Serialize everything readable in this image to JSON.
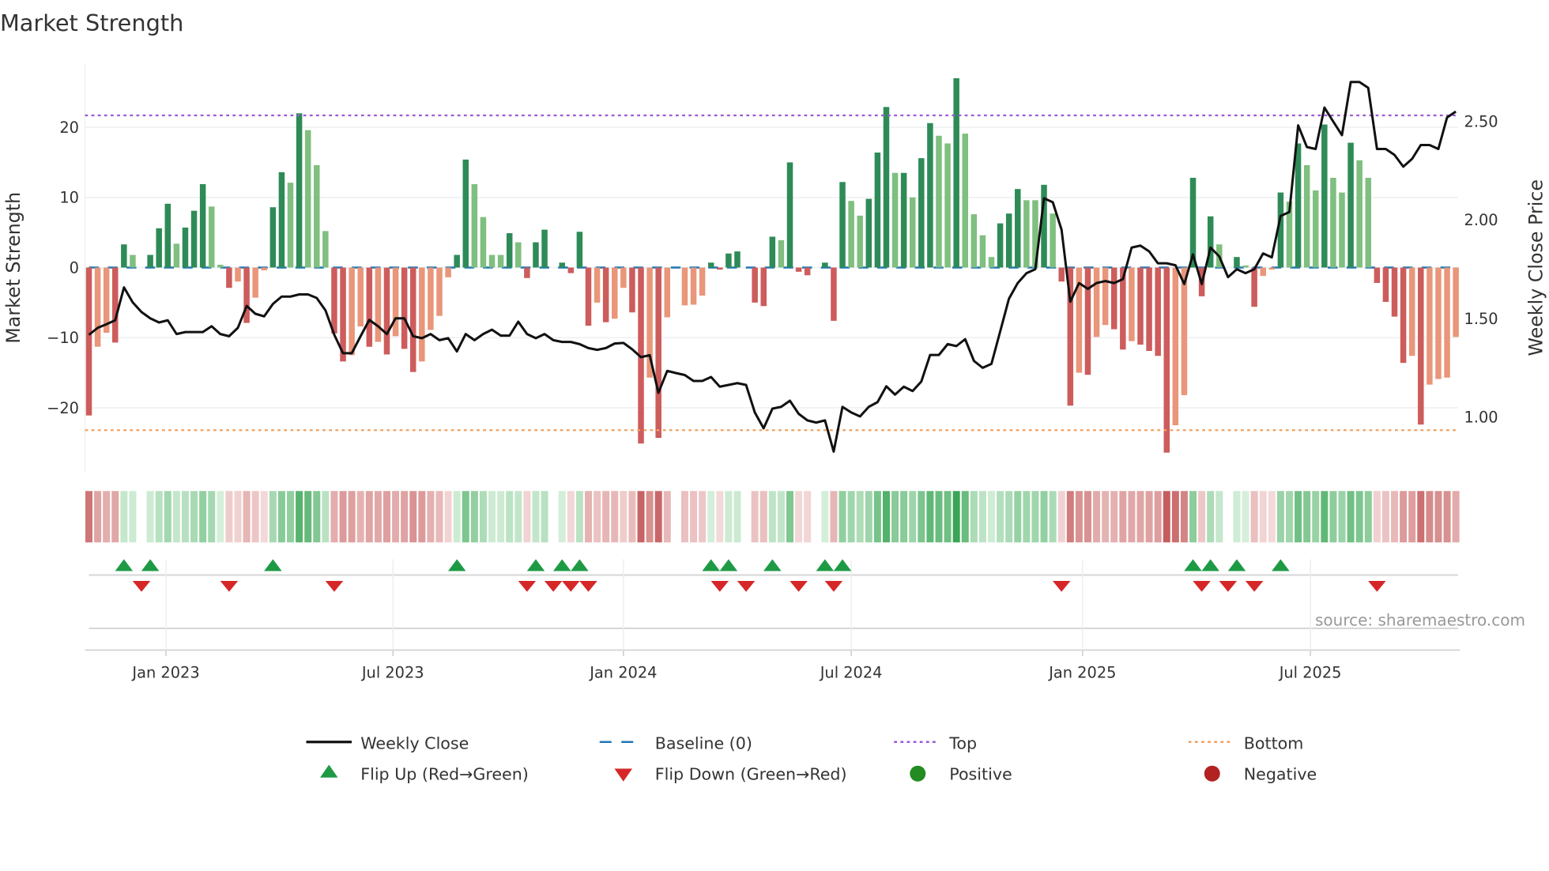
{
  "title": "Market Strength",
  "source": "source: sharemaestro.com",
  "colors": {
    "pos_strong": "#2e8b57",
    "pos_weak": "#7fbf7f",
    "neg_strong": "#cd5c5c",
    "neg_weak": "#e9967a",
    "line": "#111111",
    "baseline": "#1f77b4",
    "top": "#9b59d6",
    "bottom": "#f0a060",
    "flip_up": "#1e9a45",
    "flip_down": "#d62728",
    "positive": "#228b22",
    "negative": "#b22222"
  },
  "legend": [
    {
      "label": "Weekly Close",
      "symbol": "line"
    },
    {
      "label": "Baseline (0)",
      "symbol": "dash"
    },
    {
      "label": "Top",
      "symbol": "dot-purple"
    },
    {
      "label": "Bottom",
      "symbol": "dot-orange"
    },
    {
      "label": "Flip Up (Red→Green)",
      "symbol": "triangle-up"
    },
    {
      "label": "Flip Down (Green→Red)",
      "symbol": "triangle-down"
    },
    {
      "label": "Positive",
      "symbol": "circle-green"
    },
    {
      "label": "Negative",
      "symbol": "circle-red"
    }
  ],
  "chart_data": {
    "type": "bar",
    "title": "Market Strength",
    "ylabel": "Market Strength",
    "y2label": "Weekly Close Price",
    "ylim": [
      -29.2,
      29
    ],
    "y2lim": [
      0.72,
      2.79
    ],
    "yticks": [
      {
        "v": -20,
        "label": "−20"
      },
      {
        "v": -10,
        "label": "−10"
      },
      {
        "v": 0,
        "label": "0"
      },
      {
        "v": 10,
        "label": "10"
      },
      {
        "v": 20,
        "label": "20"
      }
    ],
    "y2ticks": [
      {
        "v": 1.0,
        "label": "1.00"
      },
      {
        "v": 1.5,
        "label": "1.50"
      },
      {
        "v": 2.0,
        "label": "2.00"
      },
      {
        "v": 2.5,
        "label": "2.50"
      }
    ],
    "xticks": [
      {
        "week": 8.8,
        "label": "Jan 2023"
      },
      {
        "week": 34.7,
        "label": "Jul 2023"
      },
      {
        "week": 61.0,
        "label": "Jan 2024"
      },
      {
        "week": 87.0,
        "label": "Jul 2024"
      },
      {
        "week": 113.4,
        "label": "Jan 2025"
      },
      {
        "week": 139.4,
        "label": "Jul 2025"
      }
    ],
    "top_level": 21.7,
    "bottom_level": -23.2,
    "baseline": 0,
    "grid": true,
    "legend_position": "bottom",
    "strength": [
      -21.1,
      -11.3,
      -9.3,
      -10.7,
      3.3,
      1.8,
      0,
      1.8,
      5.6,
      9.1,
      3.4,
      5.7,
      8.1,
      11.9,
      8.7,
      0.4,
      -2.9,
      -2.0,
      -7.9,
      -4.3,
      -0.4,
      8.6,
      13.6,
      12.1,
      22.0,
      19.6,
      14.6,
      5.2,
      -9.4,
      -13.4,
      -12.5,
      -8.4,
      -11.3,
      -10.6,
      -12.4,
      -9.8,
      -11.6,
      -14.9,
      -13.4,
      -8.9,
      -6.9,
      -1.4,
      1.8,
      15.4,
      11.9,
      7.2,
      1.8,
      1.8,
      4.9,
      3.6,
      -1.5,
      3.6,
      5.4,
      0,
      0.7,
      -0.8,
      5.1,
      -8.3,
      -5.0,
      -7.8,
      -7.3,
      -2.9,
      -6.4,
      -25.1,
      -15.7,
      -24.3,
      -7.1,
      0,
      -5.4,
      -5.3,
      -4.0,
      0.7,
      -0.3,
      2.0,
      2.3,
      0,
      -5.0,
      -5.5,
      4.4,
      3.9,
      15.0,
      -0.6,
      -1.1,
      0,
      0.7,
      -7.6,
      12.2,
      9.5,
      7.4,
      9.8,
      16.4,
      22.9,
      13.5,
      13.5,
      10.0,
      15.6,
      20.6,
      18.8,
      17.7,
      27.0,
      19.1,
      7.6,
      4.6,
      1.5,
      6.3,
      7.7,
      11.2,
      9.6,
      9.6,
      11.8,
      7.7,
      -2.0,
      -19.7,
      -15.0,
      -15.3,
      -9.9,
      -8.2,
      -8.8,
      -11.7,
      -10.5,
      -11.0,
      -11.9,
      -12.6,
      -26.4,
      -22.5,
      -18.2,
      12.8,
      -4.1,
      7.3,
      3.3,
      0,
      1.5,
      0.3,
      -5.6,
      -1.2,
      -0.3,
      10.7,
      9.4,
      17.7,
      14.6,
      11.0,
      20.4,
      12.8,
      10.7,
      17.8,
      15.3,
      12.8,
      -2.2,
      -4.9,
      -7.0,
      -13.6,
      -12.6,
      -22.4,
      -16.7,
      -15.9,
      -15.7,
      -9.9
    ],
    "shade": "RrrRGg0GGGgGGGggRrRrrGGgGgggRRrrRrRrRRrrrrGGggggGgRGG0GRGRrRrrRRrRr0rrrGRGG0RRGgGRR0GRGggGGGgGgGGggGggggGGGggGgRRrRrrRRrRRRRrrGRGg0GgRrrGgGggGggGggRRRRrRrrrr",
    "weekly_close": [
      1.417,
      1.453,
      1.471,
      1.491,
      1.658,
      1.582,
      1.533,
      1.501,
      1.48,
      1.491,
      1.421,
      1.431,
      1.431,
      1.431,
      1.461,
      1.421,
      1.41,
      1.453,
      1.564,
      1.524,
      1.511,
      1.574,
      1.611,
      1.611,
      1.622,
      1.622,
      1.604,
      1.541,
      1.417,
      1.324,
      1.324,
      1.41,
      1.493,
      1.461,
      1.421,
      1.501,
      1.501,
      1.41,
      1.4,
      1.421,
      1.39,
      1.4,
      1.333,
      1.421,
      1.39,
      1.421,
      1.443,
      1.413,
      1.413,
      1.484,
      1.421,
      1.4,
      1.421,
      1.39,
      1.381,
      1.381,
      1.37,
      1.35,
      1.341,
      1.35,
      1.373,
      1.376,
      1.344,
      1.304,
      1.314,
      1.123,
      1.234,
      1.223,
      1.213,
      1.183,
      1.183,
      1.203,
      1.154,
      1.163,
      1.172,
      1.163,
      1.023,
      0.943,
      1.043,
      1.052,
      1.083,
      1.016,
      0.983,
      0.972,
      0.983,
      0.825,
      1.052,
      1.023,
      1.003,
      1.052,
      1.076,
      1.156,
      1.114,
      1.154,
      1.132,
      1.18,
      1.315,
      1.315,
      1.37,
      1.36,
      1.395,
      1.285,
      1.25,
      1.27,
      1.435,
      1.6,
      1.68,
      1.73,
      1.75,
      2.11,
      2.09,
      1.95,
      1.585,
      1.68,
      1.65,
      1.68,
      1.69,
      1.68,
      1.7,
      1.86,
      1.87,
      1.84,
      1.78,
      1.78,
      1.77,
      1.675,
      1.825,
      1.675,
      1.86,
      1.815,
      1.71,
      1.75,
      1.73,
      1.75,
      1.83,
      1.81,
      2.02,
      2.04,
      2.48,
      2.37,
      2.36,
      2.57,
      2.5,
      2.43,
      2.7,
      2.7,
      2.67,
      2.36,
      2.36,
      2.33,
      2.27,
      2.31,
      2.38,
      2.38,
      2.36,
      2.52,
      2.55
    ],
    "flip_up_weeks": [
      5,
      8,
      22,
      43,
      52,
      55,
      57,
      72,
      74,
      79,
      85,
      87,
      127,
      129,
      132,
      137
    ],
    "flip_down_weeks": [
      7,
      17,
      29,
      51,
      54,
      56,
      58,
      73,
      76,
      82,
      86,
      112,
      128,
      131,
      134,
      148
    ]
  }
}
